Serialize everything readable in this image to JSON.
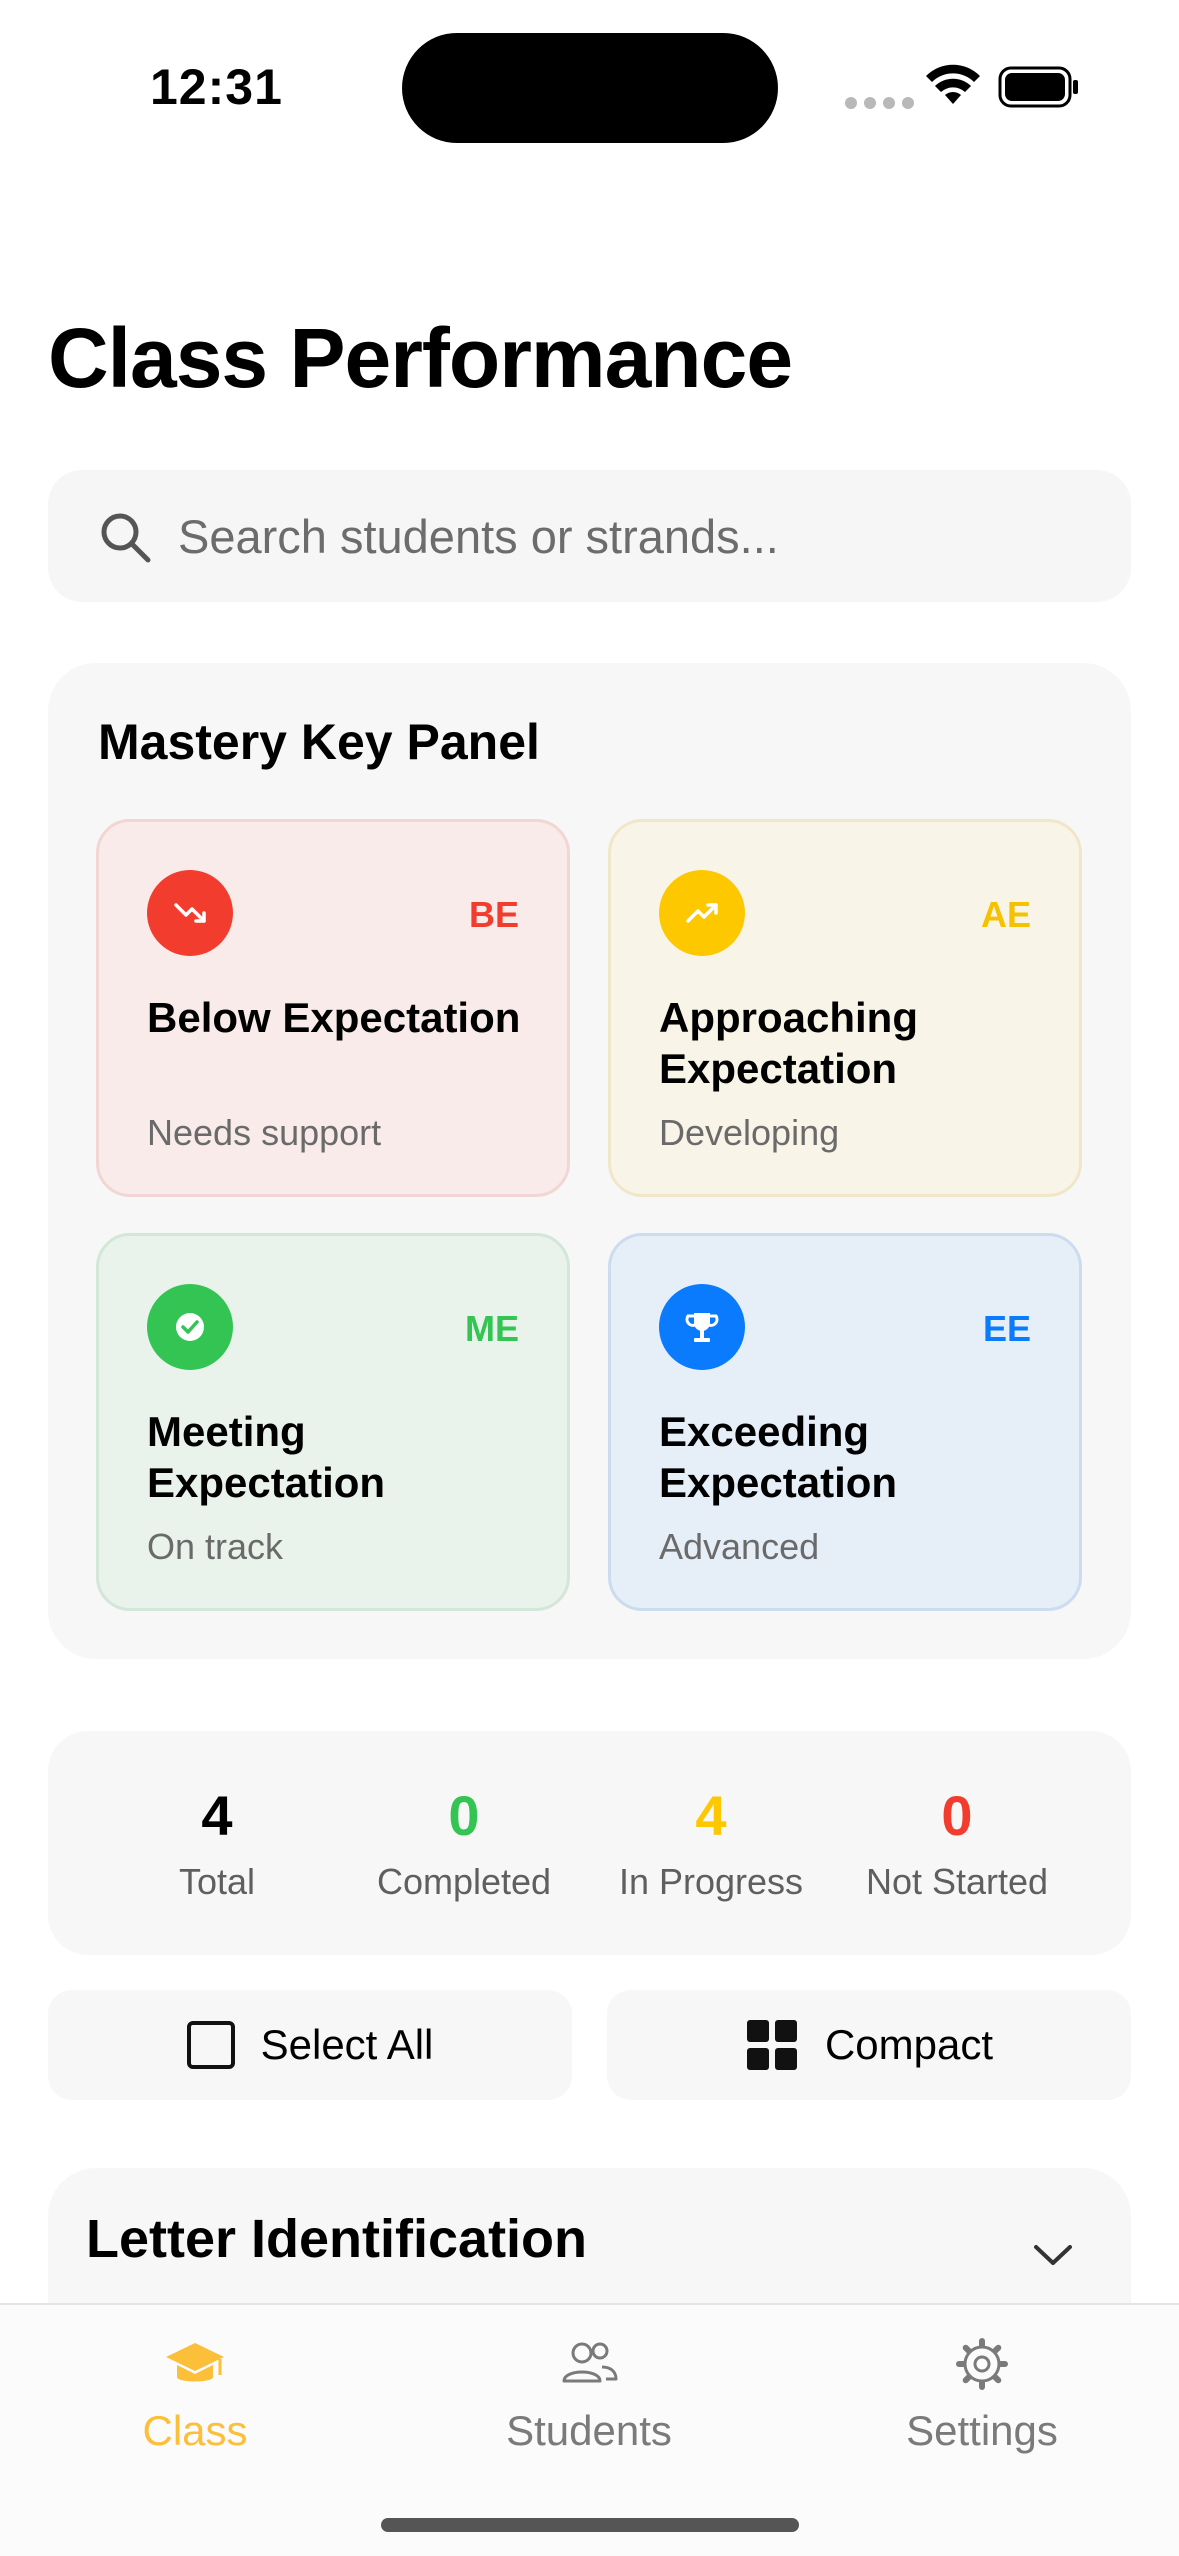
{
  "status": {
    "time": "12:31"
  },
  "page_title": "Class Performance",
  "search": {
    "placeholder": "Search students or strands..."
  },
  "mastery_panel": {
    "title": "Mastery Key Panel",
    "cards": [
      {
        "code": "BE",
        "label": "Below Expectation",
        "sub": "Needs support",
        "color": "#f23c2e",
        "icon": "trending-down-icon"
      },
      {
        "code": "AE",
        "label": "Approaching Expectation",
        "sub": "Developing",
        "color": "#fdc800",
        "icon": "trending-up-icon"
      },
      {
        "code": "ME",
        "label": "Meeting Expectation",
        "sub": "On track",
        "color": "#34c454",
        "icon": "checkmark-icon"
      },
      {
        "code": "EE",
        "label": "Exceeding Expectation",
        "sub": "Advanced",
        "color": "#0a7bfd",
        "icon": "trophy-icon"
      }
    ]
  },
  "stats": [
    {
      "value": "4",
      "label": "Total",
      "color": "#000000"
    },
    {
      "value": "0",
      "label": "Completed",
      "color": "#34c454"
    },
    {
      "value": "4",
      "label": "In Progress",
      "color": "#fdc800"
    },
    {
      "value": "0",
      "label": "Not Started",
      "color": "#f23c2e"
    }
  ],
  "actions": {
    "select_all": "Select All",
    "compact": "Compact"
  },
  "section": {
    "title": "Letter Identification"
  },
  "tabs": [
    {
      "label": "Class",
      "icon": "graduation-cap-icon",
      "active": true
    },
    {
      "label": "Students",
      "icon": "people-icon",
      "active": false
    },
    {
      "label": "Settings",
      "icon": "gear-icon",
      "active": false
    }
  ],
  "colors": {
    "accent": "#fbbf3a",
    "inactive_tab": "#7a7a7a"
  }
}
